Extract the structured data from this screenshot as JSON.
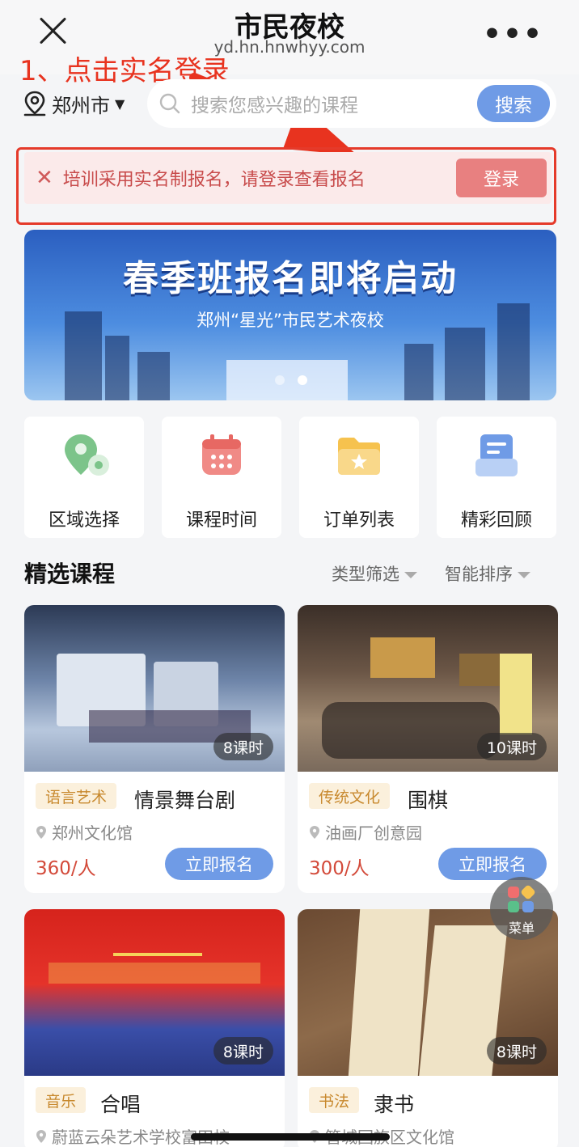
{
  "header": {
    "title": "市民夜校",
    "domain": "yd.hn.hnwhyy.com",
    "annotation": "1、点击实名登录"
  },
  "location": {
    "city": "郑州市"
  },
  "search": {
    "placeholder": "搜索您感兴趣的课程",
    "button": "搜索"
  },
  "notice": {
    "text": "培训采用实名制报名，请登录查看报名",
    "login_button": "登录"
  },
  "banner": {
    "title": "春季班报名即将启动",
    "subtitle": "郑州“星光”市民艺术夜校",
    "active_slide": 1,
    "slide_count": 2
  },
  "categories": [
    {
      "label": "区域选择",
      "icon": "location-pin-icon"
    },
    {
      "label": "课程时间",
      "icon": "calendar-icon"
    },
    {
      "label": "订单列表",
      "icon": "folder-star-icon"
    },
    {
      "label": "精彩回顾",
      "icon": "document-icon"
    }
  ],
  "section": {
    "title": "精选课程",
    "filter_type": "类型筛选",
    "filter_sort": "智能排序"
  },
  "courses": [
    {
      "hours": "8课时",
      "tag": "语言艺术",
      "name": "情景舞台剧",
      "place": "郑州文化馆",
      "price": "360/人",
      "button": "立即报名"
    },
    {
      "hours": "10课时",
      "tag": "传统文化",
      "name": "围棋",
      "place": "油画厂创意园",
      "price": "300/人",
      "button": "立即报名"
    },
    {
      "hours": "8课时",
      "tag": "音乐",
      "name": "合唱",
      "place": "蔚蓝云朵艺术学校富田校"
    },
    {
      "hours": "8课时",
      "tag": "书法",
      "name": "隶书",
      "place": "管城回族区文化馆"
    }
  ],
  "fab": {
    "label": "菜单"
  },
  "colors": {
    "accent": "#6f9be6",
    "notice_bg": "#fbeaea",
    "annotation_red": "#e8331f",
    "price": "#d34a3a"
  }
}
